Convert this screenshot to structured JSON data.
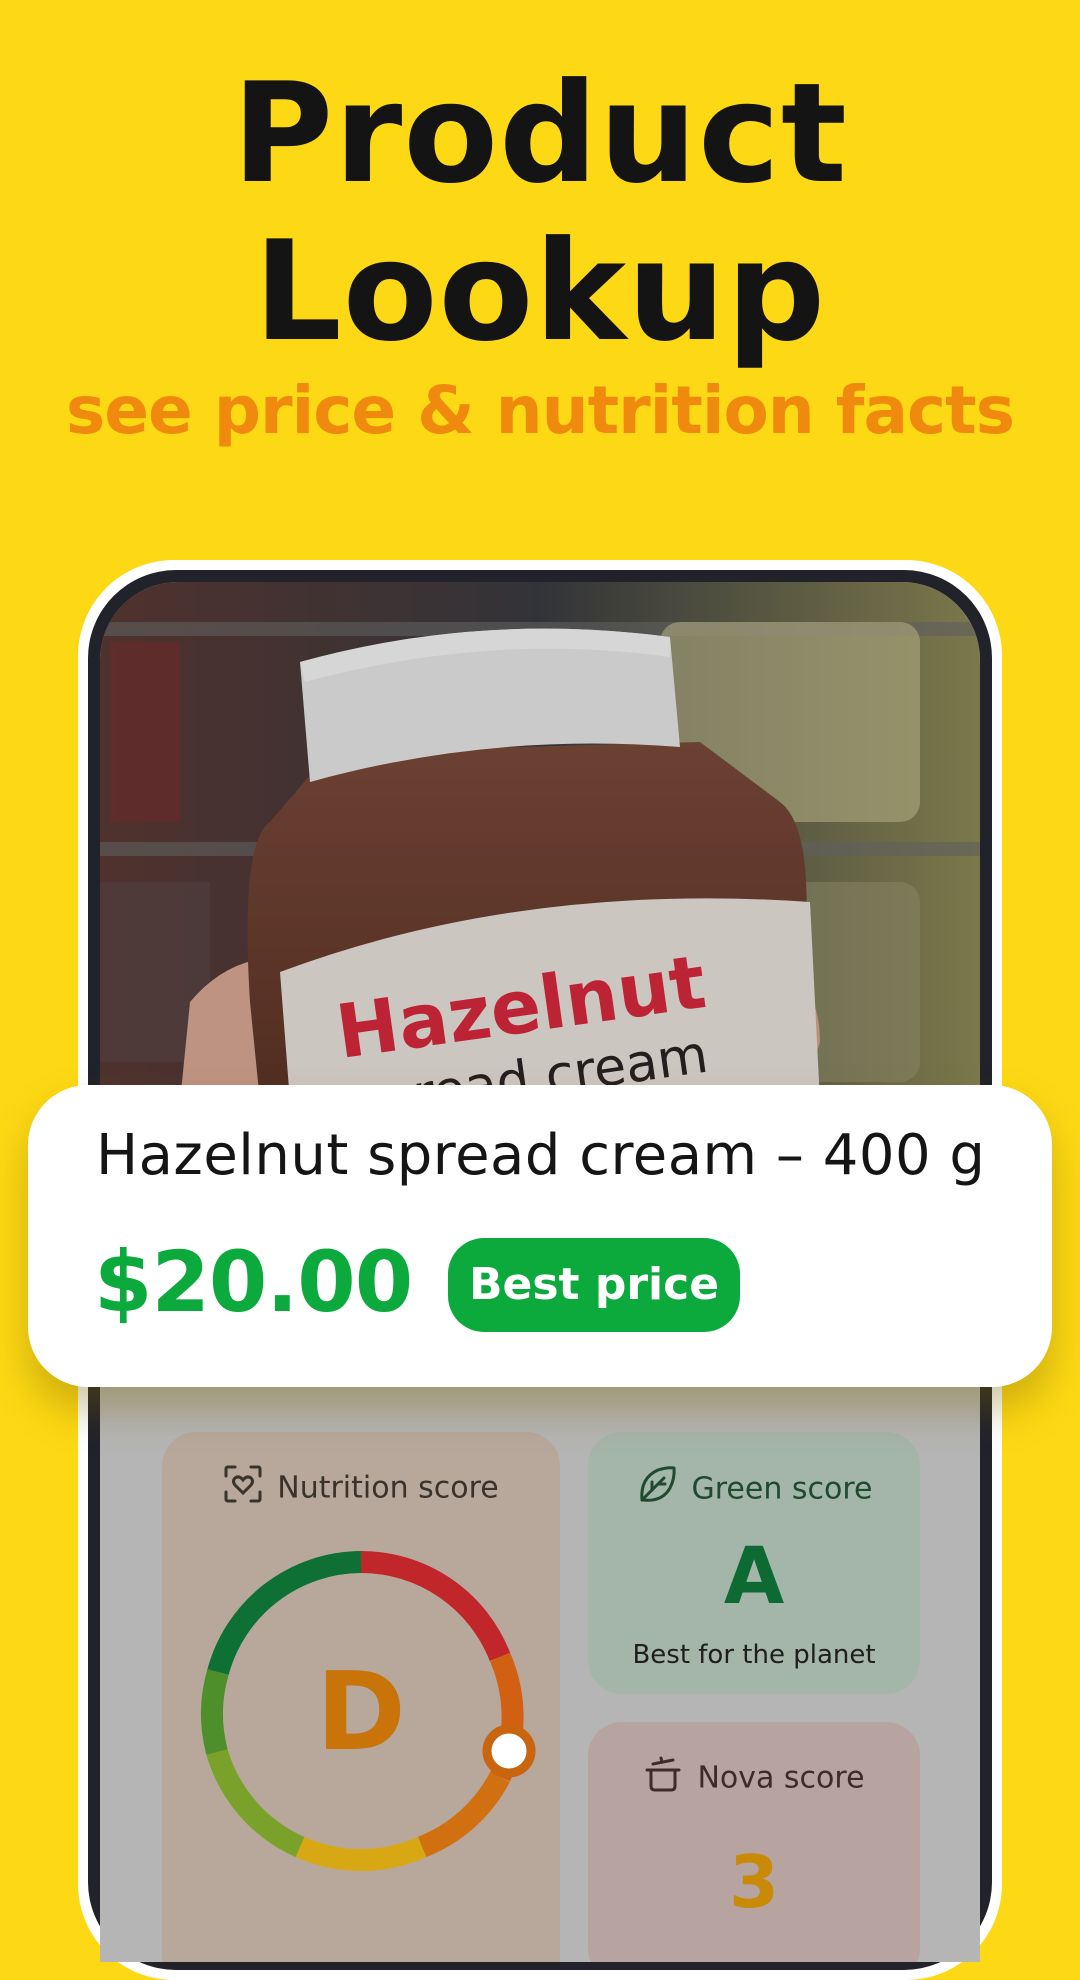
{
  "header": {
    "title_line1": "Product",
    "title_line2": "Lookup",
    "subtitle": "see price & nutrition facts"
  },
  "product": {
    "jar_brand": "Hazelnut",
    "jar_sub": "spread cream",
    "name": "Hazelnut spread cream – 400 g",
    "price": "$20.00",
    "badge": "Best price"
  },
  "scores": {
    "nutrition": {
      "label": "Nutrition score",
      "grade": "D",
      "level_fraction": 0.72
    },
    "green": {
      "label": "Green score",
      "grade": "A",
      "caption": "Best for the planet"
    },
    "nova": {
      "label": "Nova score",
      "value": "3"
    }
  },
  "colors": {
    "background": "#FDD814",
    "accent_orange": "#F08A0E",
    "price_green": "#0CA93C",
    "green_grade": "#0E6A33",
    "d_grade": "#C97408"
  },
  "icons": {
    "nutrition": "heart-scan-icon",
    "green": "leaf-icon",
    "nova": "cooking-pot-icon"
  }
}
